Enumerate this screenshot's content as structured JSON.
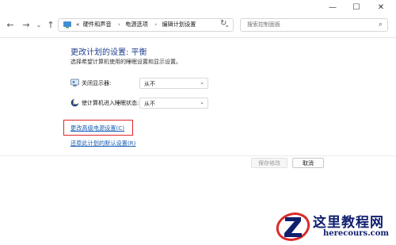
{
  "window": {
    "minimize": "—",
    "maximize": "☐",
    "close": "✕"
  },
  "nav": {
    "back": "←",
    "forward": "→",
    "history": "⌄",
    "up": "↑",
    "refresh": "↻"
  },
  "breadcrumb": {
    "overflow": "«",
    "items": [
      "硬件和声音",
      "电源选项",
      "编辑计划设置"
    ]
  },
  "search": {
    "placeholder": "搜索控制面板"
  },
  "page": {
    "title": "更改计划的设置: 平衡",
    "subtitle": "选择希望计算机使用的睡眠设置和显示设置。"
  },
  "settings": [
    {
      "label": "关闭显示器:",
      "value": "从不",
      "icon": "monitor-icon"
    },
    {
      "label": "使计算机进入睡眠状态:",
      "value": "从不",
      "icon": "sleep-moon-icon"
    }
  ],
  "links": {
    "advanced": "更改高级电源设置(C)",
    "restore": "还原此计划的默认设置(R)"
  },
  "buttons": {
    "save": "保存修改",
    "cancel": "取消"
  },
  "watermark": {
    "name": "这里教程网",
    "url": "herecours.com"
  },
  "colors": {
    "title": "#1f3f8f",
    "link": "#1a5fb4",
    "highlight_box": "#e0272a",
    "watermark": "#0f1f6e"
  }
}
